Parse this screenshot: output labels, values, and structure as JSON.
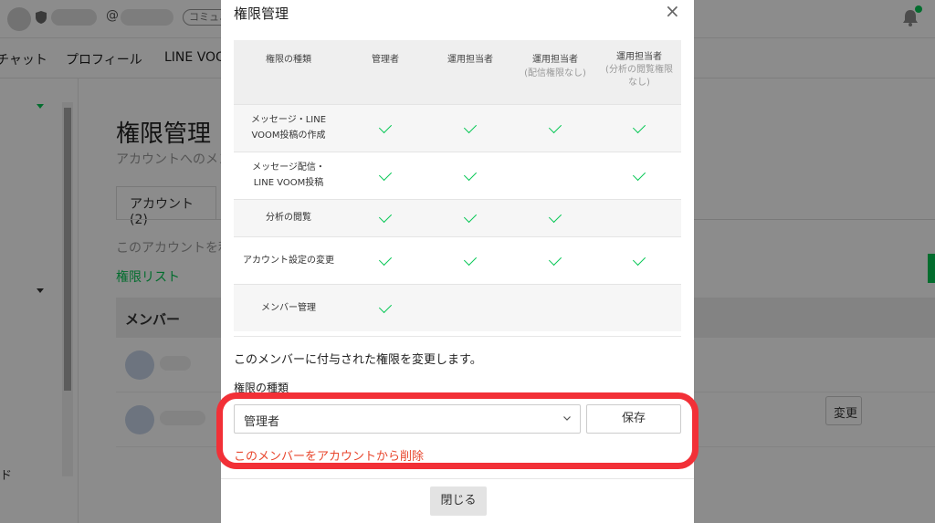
{
  "background": {
    "at_symbol": "@",
    "community_badge": "コミュニ",
    "nav": [
      "チャット",
      "プロフィール",
      "LINE VOOM"
    ],
    "page_title": "権限管理",
    "subtitle": "アカウントへのメン",
    "tab_label": "アカウント (2)",
    "description": "このアカウントを利",
    "permission_list_link": "権限リスト",
    "member_header": "メンバー",
    "change_button": "変更",
    "sidebar_bottom_text": "ド"
  },
  "modal": {
    "title": "権限管理",
    "close_icon": "×",
    "table": {
      "headers": [
        {
          "main": "権限の種類",
          "sub": ""
        },
        {
          "main": "管理者",
          "sub": ""
        },
        {
          "main": "運用担当者",
          "sub": ""
        },
        {
          "main": "運用担当者",
          "sub": "(配信権限なし)"
        },
        {
          "main": "運用担当者",
          "sub": "(分析の閲覧権限なし)"
        }
      ],
      "rows": [
        {
          "label": "メッセージ・LINE VOOM投稿の作成",
          "checks": [
            true,
            true,
            true,
            true
          ]
        },
        {
          "label": "メッセージ配信・LINE VOOM投稿",
          "checks": [
            true,
            true,
            false,
            true
          ]
        },
        {
          "label": "分析の閲覧",
          "checks": [
            true,
            true,
            true,
            false
          ]
        },
        {
          "label": "アカウント設定の変更",
          "checks": [
            true,
            true,
            true,
            true
          ]
        },
        {
          "label": "メンバー管理",
          "checks": [
            true,
            false,
            false,
            false
          ]
        }
      ]
    },
    "change_description": "このメンバーに付与された権限を変更します。",
    "type_label": "権限の種類",
    "select_value": "管理者",
    "save_label": "保存",
    "delete_link": "このメンバーをアカウントから削除",
    "close_button": "閉じる"
  },
  "colors": {
    "accent_green": "#06c755",
    "danger_red": "#e8462d",
    "highlight_red": "#f23037"
  }
}
